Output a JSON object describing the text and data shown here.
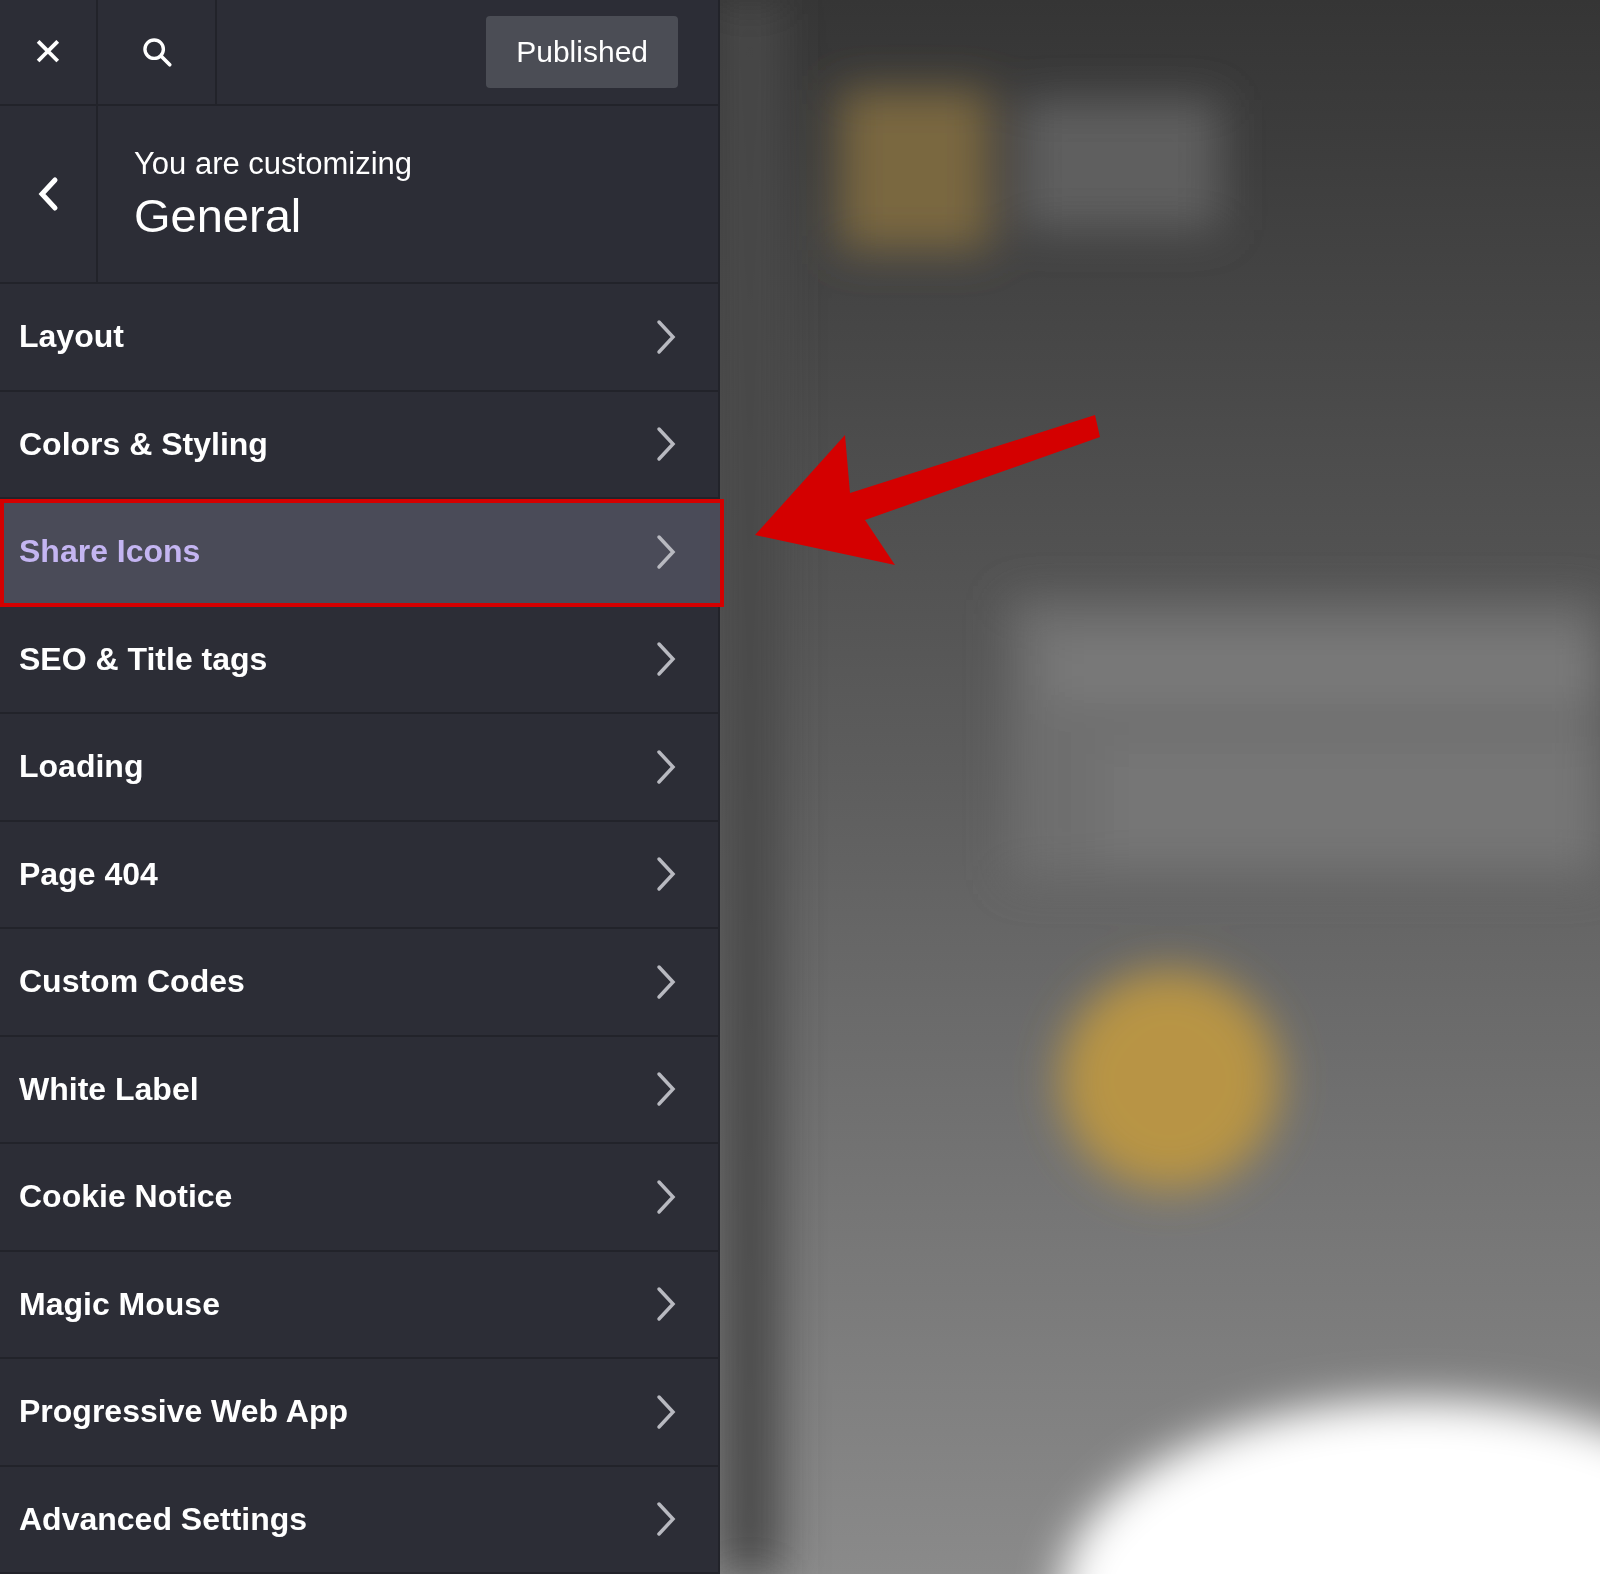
{
  "toolbar": {
    "close_icon": "✕",
    "publish_button": "Published"
  },
  "header": {
    "subtitle": "You are customizing",
    "title": "General"
  },
  "menu": [
    {
      "label": "Layout",
      "selected": false
    },
    {
      "label": "Colors & Styling",
      "selected": false
    },
    {
      "label": "Share Icons",
      "selected": true
    },
    {
      "label": "SEO & Title tags",
      "selected": false
    },
    {
      "label": "Loading",
      "selected": false
    },
    {
      "label": "Page 404",
      "selected": false
    },
    {
      "label": "Custom Codes",
      "selected": false
    },
    {
      "label": "White Label",
      "selected": false
    },
    {
      "label": "Cookie Notice",
      "selected": false
    },
    {
      "label": "Magic Mouse",
      "selected": false
    },
    {
      "label": "Progressive Web App",
      "selected": false
    },
    {
      "label": "Advanced Settings",
      "selected": false
    }
  ]
}
